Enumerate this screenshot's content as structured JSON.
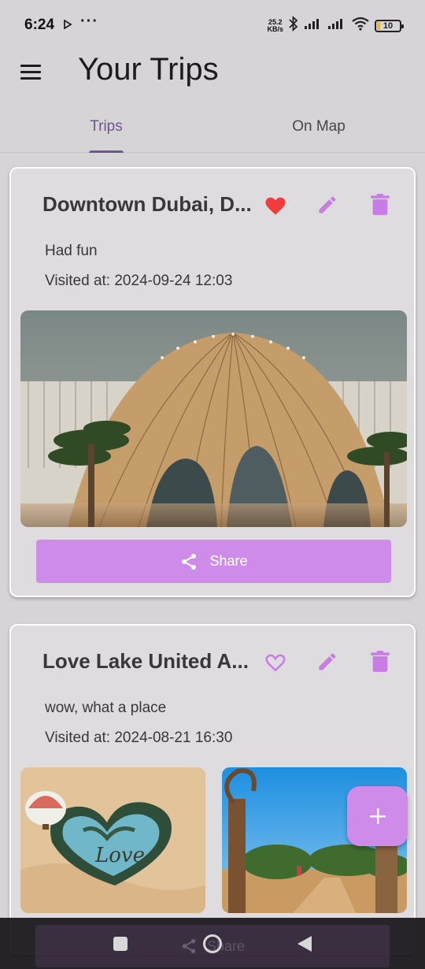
{
  "status": {
    "time": "6:24",
    "more": "···",
    "net_speed_value": "25.2",
    "net_speed_unit": "KB/s",
    "battery": "10"
  },
  "app": {
    "title": "Your Trips"
  },
  "tabs": [
    {
      "label": "Trips",
      "selected": true
    },
    {
      "label": "On Map",
      "selected": false
    }
  ],
  "trips": [
    {
      "title": "Downtown Dubai, D...",
      "favorite": true,
      "description": "Had fun",
      "visited": "Visited at: 2024-09-24 12:03",
      "share_label": "Share"
    },
    {
      "title": "Love Lake United A...",
      "favorite": false,
      "description": "wow, what a place",
      "visited": "Visited at: 2024-08-21 16:30",
      "share_label": "Share"
    }
  ],
  "fab": {
    "icon": "plus-icon"
  },
  "colors": {
    "accent": "#cf8bea",
    "primary": "#6f5595",
    "favorite": "#f23b3b",
    "background": "#d6d4d6"
  }
}
